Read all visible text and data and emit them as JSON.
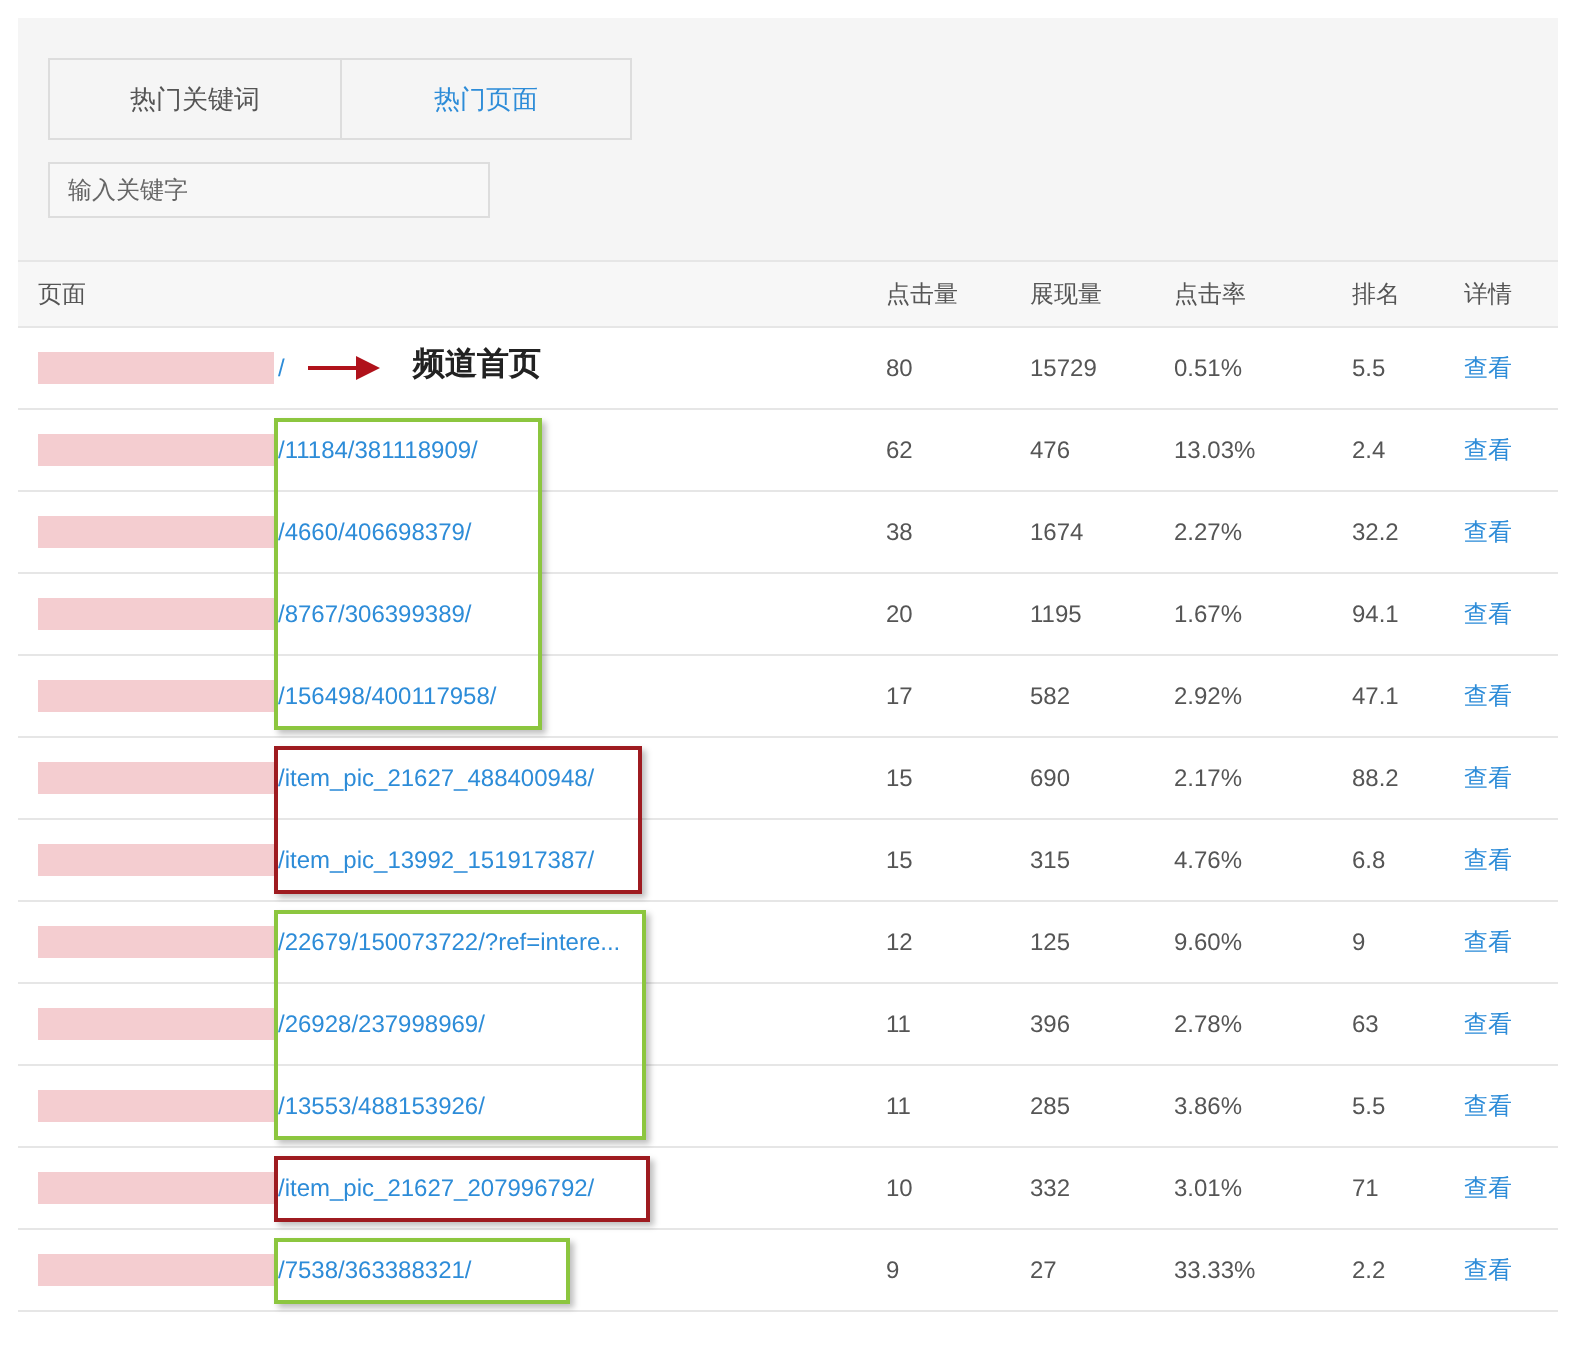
{
  "tabs": [
    {
      "label": "热门关键词",
      "selected": false
    },
    {
      "label": "热门页面",
      "selected": true
    }
  ],
  "search": {
    "placeholder": "输入关键字"
  },
  "table": {
    "columns": [
      "页面",
      "点击量",
      "展现量",
      "点击率",
      "排名",
      "详情"
    ],
    "row_groups": [
      {
        "note": "频道首页",
        "rows": [
          {
            "page": "/",
            "clicks": "80",
            "impressions": "15729",
            "ctr": "0.51%",
            "rank": "5.5",
            "details": "查看"
          }
        ]
      },
      {
        "color": "#8cc63f",
        "rows": [
          {
            "page": "/11184/381118909/",
            "clicks": "62",
            "impressions": "476",
            "ctr": "13.03%",
            "rank": "2.4",
            "details": "查看"
          },
          {
            "page": "/4660/406698379/",
            "clicks": "38",
            "impressions": "1674",
            "ctr": "2.27%",
            "rank": "32.2",
            "details": "查看"
          },
          {
            "page": "/8767/306399389/",
            "clicks": "20",
            "impressions": "1195",
            "ctr": "1.67%",
            "rank": "94.1",
            "details": "查看"
          },
          {
            "page": "/156498/400117958/",
            "clicks": "17",
            "impressions": "582",
            "ctr": "2.92%",
            "rank": "47.1",
            "details": "查看"
          }
        ]
      },
      {
        "color": "#9e1b20",
        "rows": [
          {
            "page": "/item_pic_21627_488400948/",
            "clicks": "15",
            "impressions": "690",
            "ctr": "2.17%",
            "rank": "88.2",
            "details": "查看"
          },
          {
            "page": "/item_pic_13992_151917387/",
            "clicks": "15",
            "impressions": "315",
            "ctr": "4.76%",
            "rank": "6.8",
            "details": "查看"
          }
        ]
      },
      {
        "color": "#8cc63f",
        "rows": [
          {
            "page": "/22679/150073722/?ref=intere...",
            "clicks": "12",
            "impressions": "125",
            "ctr": "9.60%",
            "rank": "9",
            "details": "查看"
          },
          {
            "page": "/26928/237998969/",
            "clicks": "11",
            "impressions": "396",
            "ctr": "2.78%",
            "rank": "63",
            "details": "查看"
          },
          {
            "page": "/13553/488153926/",
            "clicks": "11",
            "impressions": "285",
            "ctr": "3.86%",
            "rank": "5.5",
            "details": "查看"
          }
        ]
      },
      {
        "color": "#9e1b20",
        "rows": [
          {
            "page": "/item_pic_21627_207996792/",
            "clicks": "10",
            "impressions": "332",
            "ctr": "3.01%",
            "rank": "71",
            "details": "查看"
          }
        ]
      },
      {
        "color": "#8cc63f",
        "rows": [
          {
            "page": "/7538/363388321/",
            "clicks": "9",
            "impressions": "27",
            "ctr": "33.33%",
            "rank": "2.2",
            "details": "查看"
          }
        ]
      }
    ]
  }
}
